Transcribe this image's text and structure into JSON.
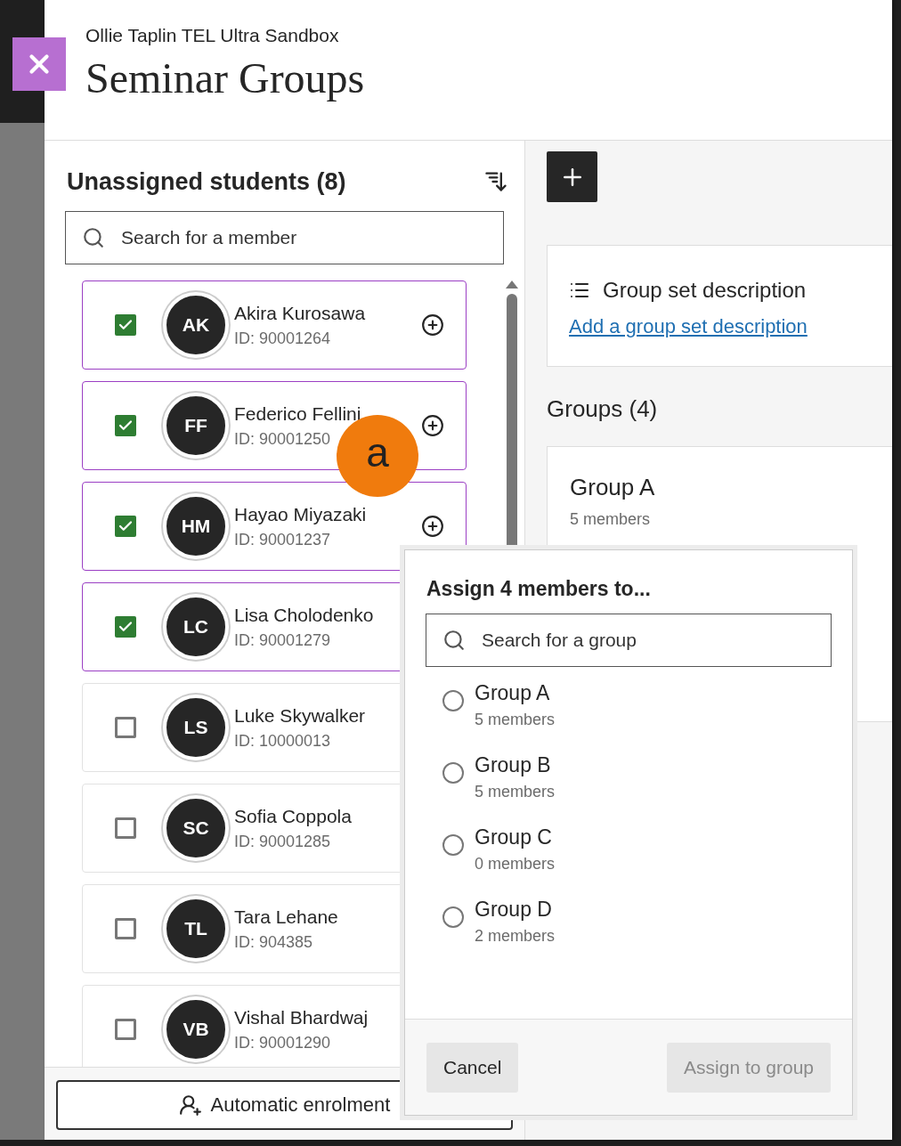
{
  "header": {
    "course": "Ollie Taplin TEL Ultra Sandbox",
    "title": "Seminar Groups"
  },
  "unassigned": {
    "title": "Unassigned students (8)",
    "search": {
      "placeholder": "Search for a member"
    },
    "students": [
      {
        "initials": "AK",
        "name": "Akira Kurosawa",
        "id": "ID: 90001264",
        "checked": true,
        "add_button": true
      },
      {
        "initials": "FF",
        "name": "Federico Fellini",
        "id": "ID: 90001250",
        "checked": true,
        "add_button": true
      },
      {
        "initials": "HM",
        "name": "Hayao Miyazaki",
        "id": "ID: 90001237",
        "checked": true,
        "add_button": true
      },
      {
        "initials": "LC",
        "name": "Lisa Cholodenko",
        "id": "ID: 90001279",
        "checked": true,
        "add_button": false
      },
      {
        "initials": "LS",
        "name": "Luke Skywalker",
        "id": "ID: 10000013",
        "checked": false,
        "add_button": false
      },
      {
        "initials": "SC",
        "name": "Sofia Coppola",
        "id": "ID: 90001285",
        "checked": false,
        "add_button": false
      },
      {
        "initials": "TL",
        "name": "Tara Lehane",
        "id": "ID: 904385",
        "checked": false,
        "add_button": false
      },
      {
        "initials": "VB",
        "name": "Vishal Bhardwaj",
        "id": "ID: 90001290",
        "checked": false,
        "add_button": false
      }
    ],
    "automatic_button": "Automatic enrolment"
  },
  "group_set": {
    "title": "Group set description",
    "link": "Add a group set description"
  },
  "groups": {
    "title": "Groups (4)",
    "items": [
      {
        "name": "Group A",
        "members": "5 members"
      }
    ]
  },
  "annotation": "a",
  "assign_popover": {
    "title": "Assign 4 members to...",
    "search": {
      "placeholder": "Search for a group"
    },
    "options": [
      {
        "name": "Group A",
        "members": "5 members",
        "selected": false
      },
      {
        "name": "Group B",
        "members": "5 members",
        "selected": false
      },
      {
        "name": "Group C",
        "members": "0 members",
        "selected": false
      },
      {
        "name": "Group D",
        "members": "2 members",
        "selected": false
      }
    ],
    "cancel": "Cancel",
    "assign": {
      "label": "Assign to group",
      "disabled": true
    }
  }
}
